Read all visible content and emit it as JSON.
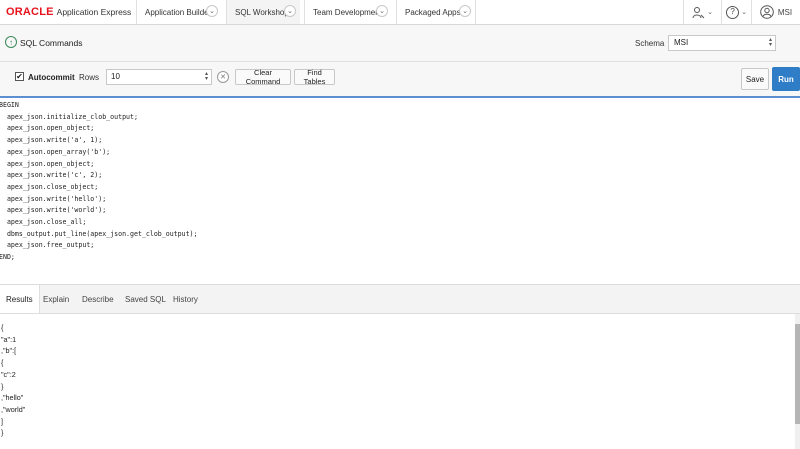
{
  "brand": {
    "logo": "ORACLE",
    "app_name": "Application Express"
  },
  "nav_tabs": [
    {
      "label": "Application Builder"
    },
    {
      "label": "SQL Workshop"
    },
    {
      "label": "Team Development"
    },
    {
      "label": "Packaged Apps"
    }
  ],
  "user": {
    "name": "MSI"
  },
  "icons": {
    "chevron": "⌄",
    "help": "?",
    "user": "👤",
    "up_arrow": "↑",
    "checkmark": "✔",
    "clear": "✕",
    "spinner_up": "▴",
    "spinner_down": "▾"
  },
  "page": {
    "title": "SQL Commands",
    "schema_label": "Schema",
    "schema_value": "MSI"
  },
  "toolbar": {
    "autocommit_label": "Autocommit",
    "autocommit_checked": true,
    "rows_label": "Rows",
    "rows_value": "10",
    "clear_label": "Clear Command",
    "find_label": "Find Tables",
    "save_label": "Save",
    "run_label": "Run"
  },
  "editor": {
    "code": "BEGIN\n  apex_json.initialize_clob_output;\n  apex_json.open_object;\n  apex_json.write('a', 1);\n  apex_json.open_array('b');\n  apex_json.open_object;\n  apex_json.write('c', 2);\n  apex_json.close_object;\n  apex_json.write('hello');\n  apex_json.write('world');\n  apex_json.close_all;\n  dbms_output.put_line(apex_json.get_clob_output);\n  apex_json.free_output;\nEND;"
  },
  "result_tabs": [
    {
      "label": "Results"
    },
    {
      "label": "Explain"
    },
    {
      "label": "Describe"
    },
    {
      "label": "Saved SQL"
    },
    {
      "label": "History"
    }
  ],
  "results": {
    "output": "{\n\"a\":1\n,\"b\":[\n{\n\"c\":2\n}\n,\"hello\"\n,\"world\"\n]\n}"
  },
  "colors": {
    "brand_red": "#e8121d",
    "run_blue": "#2f7cc7",
    "editor_border": "#5b8fcf",
    "up_icon_green": "#3a8b5a"
  }
}
